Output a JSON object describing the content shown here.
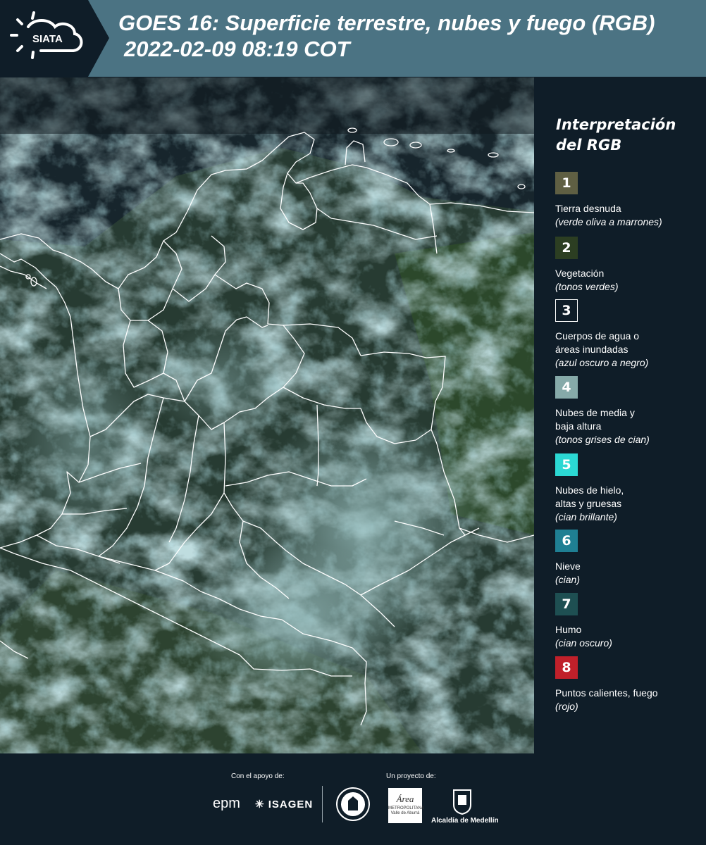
{
  "header": {
    "logo_text": "SIATA",
    "title_line1": "GOES 16: Superficie terrestre, nubes y fuego (RGB)",
    "title_line2": "2022-02-09 08:19 COT"
  },
  "legend": {
    "title_line1": "Interpretación",
    "title_line2": "del RGB",
    "items": [
      {
        "number": "1",
        "label": "Tierra desnuda",
        "sub": "(verde oliva a marrones)",
        "color": "#5f5f43"
      },
      {
        "number": "2",
        "label": "Vegetación",
        "sub": "(tonos verdes)",
        "color": "#2c3e22"
      },
      {
        "number": "3",
        "label": "Cuerpos de agua o\náreas inundadas",
        "sub": "(azul oscuro a negro)",
        "color": "#0f1d28"
      },
      {
        "number": "4",
        "label": "Nubes de media y\nbaja altura",
        "sub": "(tonos grises de cian)",
        "color": "#86aaa9"
      },
      {
        "number": "5",
        "label": "Nubes de hielo,\naltas y gruesas",
        "sub": "(cian brillante)",
        "color": "#2bd8d3"
      },
      {
        "number": "6",
        "label": "Nieve",
        "sub": "(cian)",
        "color": "#1f7f93"
      },
      {
        "number": "7",
        "label": "Humo",
        "sub": "(cian oscuro)",
        "color": "#1e4f52"
      },
      {
        "number": "8",
        "label": "Puntos calientes, fuego",
        "sub": "(rojo)",
        "color": "#c0202a"
      }
    ]
  },
  "footer": {
    "support_label": "Con el apoyo de:",
    "project_label": "Un proyecto de:",
    "epm": "epm",
    "isagen": "ISAGEN",
    "area_line1": "Área",
    "area_line2": "METROPOLITANA",
    "area_line3": "Valle de Aburrá",
    "alcaldia": "Alcaldía de Medellín"
  }
}
